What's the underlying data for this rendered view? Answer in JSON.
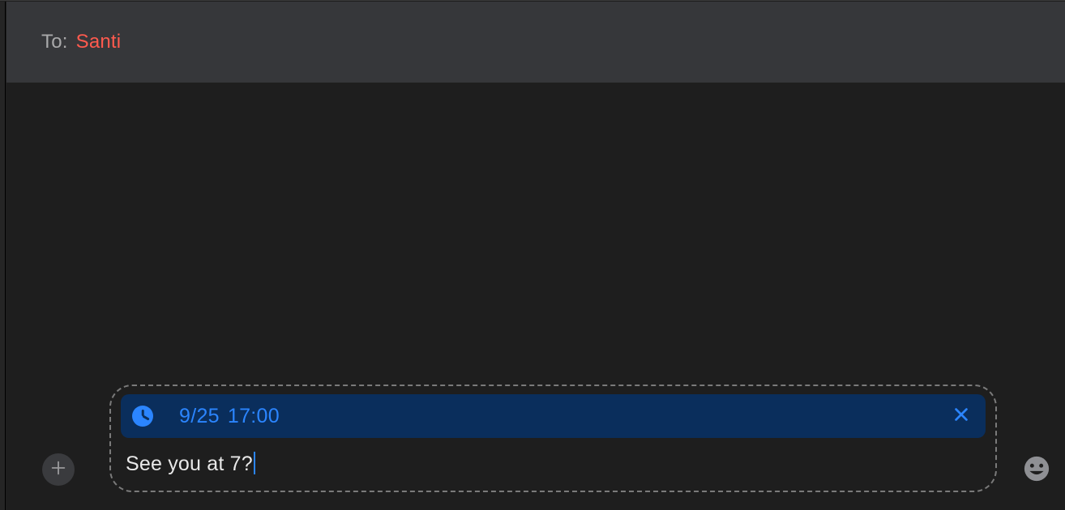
{
  "header": {
    "to_label": "To:",
    "to_value": "Santi"
  },
  "compose": {
    "schedule": {
      "date": "9/25",
      "time": "17:00",
      "icon": "clock-icon"
    },
    "message_text": "See you at 7?"
  },
  "colors": {
    "accent_blue": "#2b85ff",
    "chip_bg": "#0a2e5c",
    "recipient_red": "#ff5a4e",
    "header_bg": "#36373a",
    "body_bg": "#1e1e1e"
  }
}
